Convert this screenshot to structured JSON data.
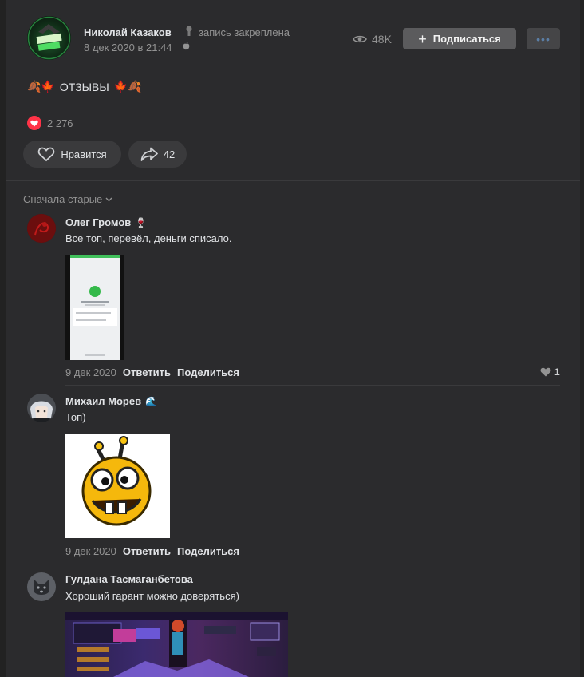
{
  "post": {
    "author": "Николай Казаков",
    "pinned_text": "запись закреплена",
    "date": "8 дек 2020 в 21:44",
    "views": "48K",
    "subscribe_label": "Подписаться",
    "text": "ОТЗЫВЫ",
    "likes_total": "2 276",
    "like_button_label": "Нравится",
    "share_count": "42"
  },
  "comments_sort": "Сначала старые",
  "comments": [
    {
      "author": "Олег Громов",
      "text": "Все топ, перевёл, деньги списало.",
      "date": "9 дек 2020",
      "reply_label": "Ответить",
      "share_label": "Поделиться",
      "likes": "1"
    },
    {
      "author": "Михаил Морев",
      "text": "Топ)",
      "date": "9 дек 2020",
      "reply_label": "Ответить",
      "share_label": "Поделиться"
    },
    {
      "author": "Гулдана Тасмаганбетова",
      "text": "Хороший гарант можно доверяться)"
    }
  ],
  "colors": {
    "background": "#222222",
    "panel": "#2b2b2d",
    "accent_heart": "#ff3347",
    "muted_text": "#939393"
  },
  "icons": [
    "eye-icon",
    "plus-icon",
    "more-icon",
    "heart-icon",
    "share-icon",
    "chevron-down-icon",
    "pin-icon",
    "apple-icon",
    "like-icon"
  ]
}
